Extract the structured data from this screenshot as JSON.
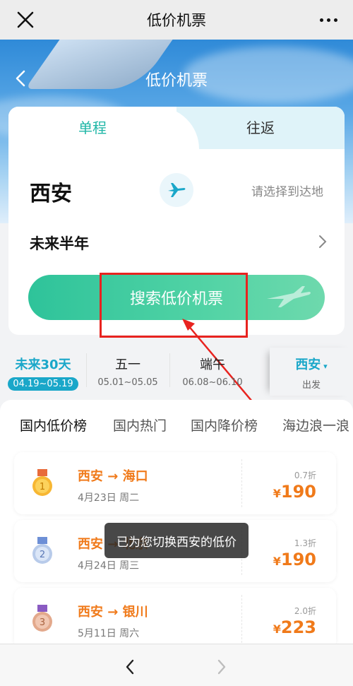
{
  "topbar": {
    "title": "低价机票"
  },
  "header": {
    "title": "低价机票"
  },
  "trip_tabs": [
    {
      "label": "单程"
    },
    {
      "label": "往返"
    }
  ],
  "search": {
    "origin": "西安",
    "destination_placeholder": "请选择到达地",
    "period": "未来半年",
    "button_label": "搜索低价机票"
  },
  "date_options": [
    {
      "title": "未来30天",
      "range": "04.19~05.19"
    },
    {
      "title": "五一",
      "range": "05.01~05.05"
    },
    {
      "title": "端午",
      "range": "06.08~06.10"
    }
  ],
  "city_selector": {
    "city": "西安",
    "caption": "出发"
  },
  "list_tabs": [
    {
      "label": "国内低价榜"
    },
    {
      "label": "国内热门"
    },
    {
      "label": "国内降价榜"
    },
    {
      "label": "海边浪一浪"
    }
  ],
  "deals": [
    {
      "rank": "1",
      "route": "西安 → 海口",
      "date": "4月23日  周二",
      "discount": "0.7折",
      "currency": "¥",
      "price": "190"
    },
    {
      "rank": "2",
      "route": "西安 → 北京",
      "date": "4月24日  周三",
      "discount": "1.3折",
      "currency": "¥",
      "price": "190"
    },
    {
      "rank": "3",
      "route": "西安 → 银川",
      "date": "5月11日  周六",
      "discount": "2.0折",
      "currency": "¥",
      "price": "223"
    }
  ],
  "toast": {
    "text": "已为您切换西安的低价"
  },
  "colors": {
    "accent": "#1eb6a6",
    "price": "#f07a1a",
    "highlight": "#e8231f"
  }
}
